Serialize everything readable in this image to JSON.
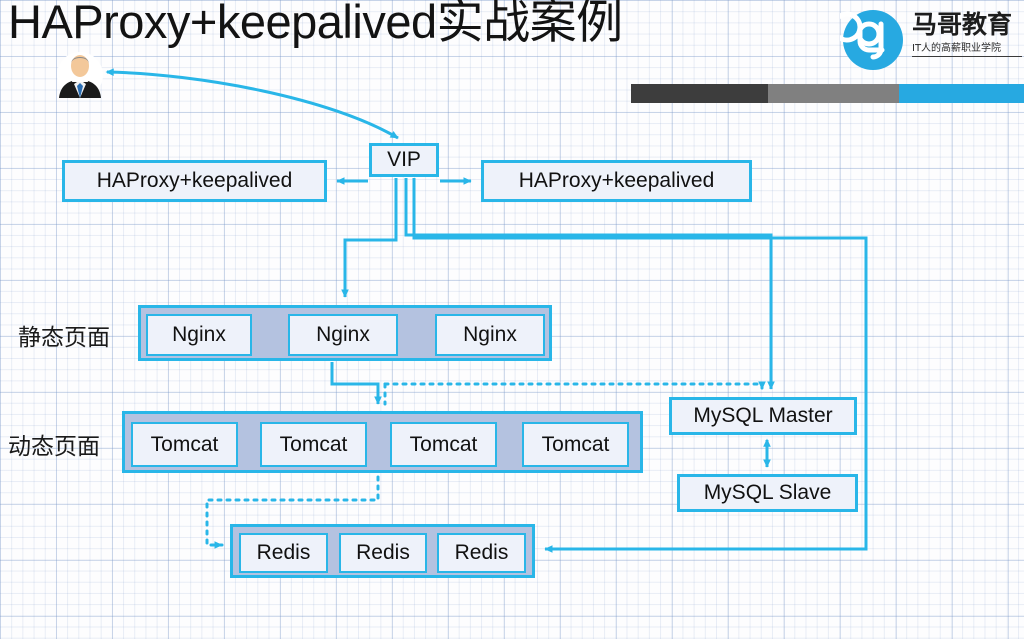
{
  "slide": {
    "title": "HAProxy+keepalived实战案例",
    "accent_color": "#29b6e8",
    "box_fill": "#eef2fa",
    "cluster_fill": "#b4c2e0",
    "background": "#fdfdfe"
  },
  "brand": {
    "name": "马哥教育",
    "tagline": "IT人的高薪职业学院",
    "logo_icon": "brand-logo-icon",
    "logo_color": "#27a9e1"
  },
  "decor_bars": [
    {
      "name": "bar-dark",
      "color": "#3d3d3d"
    },
    {
      "name": "bar-gray",
      "color": "#808080"
    },
    {
      "name": "bar-blue",
      "color": "#27a9e1"
    }
  ],
  "actor": {
    "icon": "user-avatar-icon",
    "label": ""
  },
  "nodes": {
    "vip": "VIP",
    "haproxy_left": "HAProxy+keepalived",
    "haproxy_right": "HAProxy+keepalived",
    "mysql_master": "MySQL Master",
    "mysql_slave": "MySQL Slave"
  },
  "tiers": [
    {
      "name": "static-tier",
      "label": "静态页面",
      "members": [
        "Nginx",
        "Nginx",
        "Nginx"
      ]
    },
    {
      "name": "dynamic-tier",
      "label": "动态页面",
      "members": [
        "Tomcat",
        "Tomcat",
        "Tomcat",
        "Tomcat"
      ]
    },
    {
      "name": "cache-tier",
      "label": "",
      "members": [
        "Redis",
        "Redis",
        "Redis"
      ]
    }
  ],
  "connections": [
    {
      "from": "vip",
      "to": "user",
      "style": "curved-solid",
      "arrows": "both"
    },
    {
      "from": "vip",
      "to": "haproxy_left",
      "style": "solid",
      "arrows": "end"
    },
    {
      "from": "vip",
      "to": "haproxy_right",
      "style": "solid",
      "arrows": "end"
    },
    {
      "from": "vip",
      "to": "static-tier",
      "style": "solid-orthogonal",
      "arrows": "end"
    },
    {
      "from": "vip",
      "to": "mysql_master",
      "style": "solid-orthogonal",
      "arrows": "end"
    },
    {
      "from": "static-tier",
      "to": "dynamic-tier",
      "style": "solid-orthogonal",
      "arrows": "end"
    },
    {
      "from": "dynamic-tier",
      "to": "mysql_master",
      "style": "dotted-orthogonal",
      "arrows": "end"
    },
    {
      "from": "dynamic-tier",
      "to": "cache-tier",
      "style": "dotted-orthogonal",
      "arrows": "end"
    },
    {
      "from": "mysql_master",
      "to": "mysql_slave",
      "style": "solid",
      "arrows": "both"
    },
    {
      "from": "vip",
      "to": "cache-tier",
      "style": "solid-orthogonal",
      "arrows": "end"
    }
  ]
}
